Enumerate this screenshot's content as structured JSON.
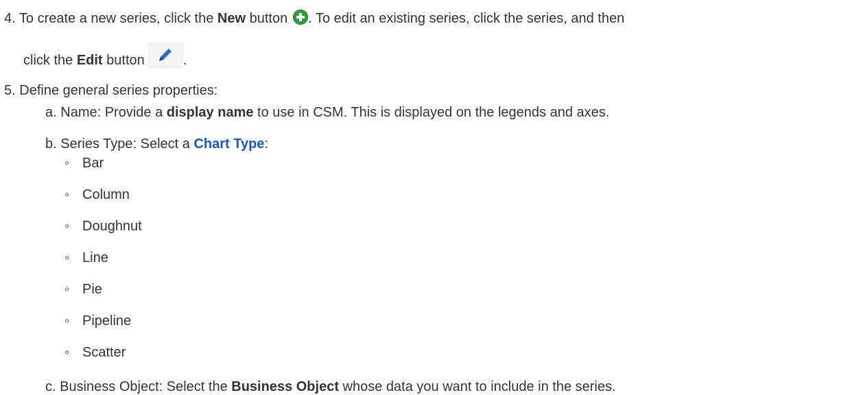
{
  "step4": {
    "number": "4.",
    "part1": "To create a new series, click the ",
    "new_label": "New",
    "part2": " button",
    "part3": ". To edit an existing series, click the series, and then",
    "part4": "click the ",
    "edit_label": "Edit",
    "part5": " button",
    "part6": "."
  },
  "step5": {
    "number": "5.",
    "text": "Define general series properties:"
  },
  "item_a": {
    "letter": "a.",
    "prefix": "Name: Provide a ",
    "bold": "display name",
    "suffix": " to use in CSM. This is displayed on the legends and axes."
  },
  "item_b": {
    "letter": "b.",
    "prefix": "Series Type: Select a ",
    "link": "Chart Type",
    "suffix": ":"
  },
  "chart_types": [
    "Bar",
    "Column",
    "Doughnut",
    "Line",
    "Pie",
    "Pipeline",
    "Scatter"
  ],
  "bullet_glyph": "◦",
  "item_c": {
    "letter": "c.",
    "prefix": "Business Object: Select the ",
    "bold": "Business Object",
    "suffix": " whose data you want to include in the series."
  },
  "icons": {
    "new": "plus-circle-icon",
    "edit": "pencil-icon"
  },
  "colors": {
    "text": "#333333",
    "link": "#1a55d6",
    "new_icon": "#2e9d3a",
    "edit_icon": "#1e6fd0"
  }
}
